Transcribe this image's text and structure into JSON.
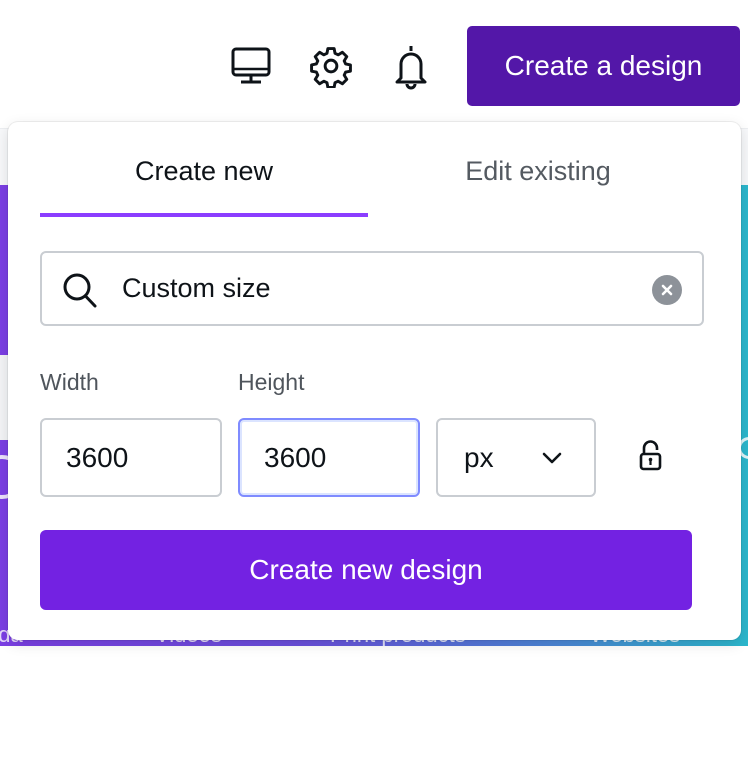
{
  "header": {
    "icons": [
      {
        "name": "desktop-icon",
        "label": "Desktop app"
      },
      {
        "name": "gear-icon",
        "label": "Settings"
      },
      {
        "name": "bell-icon",
        "label": "Notifications"
      }
    ],
    "create_button_label": "Create a design"
  },
  "popover": {
    "tabs": [
      {
        "label": "Create new",
        "active": true
      },
      {
        "label": "Edit existing",
        "active": false
      }
    ],
    "search": {
      "value": "Custom size",
      "icon": "search-icon",
      "clear_icon": "close-icon"
    },
    "width": {
      "label": "Width",
      "value": "3600"
    },
    "height": {
      "label": "Height",
      "value": "3600"
    },
    "unit": {
      "value": "px"
    },
    "lock_state": "unlocked",
    "primary_button_label": "Create new design"
  },
  "colors": {
    "brand_dark": "#5317a8",
    "primary": "#7322e2",
    "tab_underline": "#8b3dff",
    "focus_border": "#7f8bff"
  },
  "background": {
    "partial_labels": [
      "eda",
      "Videos",
      "Print products",
      "Websites"
    ]
  }
}
